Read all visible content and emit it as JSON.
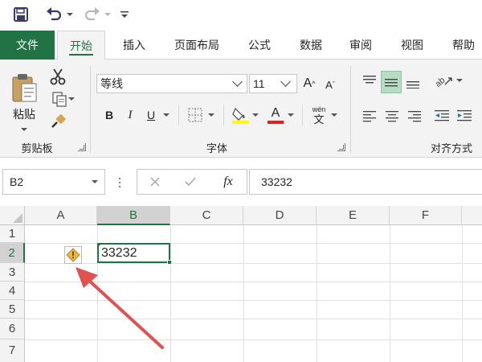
{
  "qat": {
    "save_icon": "save-icon",
    "undo_icon": "undo-icon",
    "redo_icon": "redo-icon",
    "customize_icon": "customize-qat-icon"
  },
  "tabs": [
    {
      "label": "文件",
      "active": false
    },
    {
      "label": "开始",
      "active": true
    },
    {
      "label": "插入",
      "active": false
    },
    {
      "label": "页面布局",
      "active": false
    },
    {
      "label": "公式",
      "active": false
    },
    {
      "label": "数据",
      "active": false
    },
    {
      "label": "审阅",
      "active": false
    },
    {
      "label": "视图",
      "active": false
    },
    {
      "label": "帮助",
      "active": false
    }
  ],
  "ribbon": {
    "clipboard": {
      "paste_label": "粘贴",
      "group_label": "剪贴板"
    },
    "font": {
      "font_name": "等线",
      "font_size": "11",
      "grow_label": "A",
      "shrink_label": "A",
      "bold_label": "B",
      "italic_label": "I",
      "underline_label": "U",
      "font_color_label": "A",
      "phonetic_top": "wén",
      "phonetic_bottom": "文",
      "group_label": "字体"
    },
    "alignment": {
      "group_label": "对齐方式"
    }
  },
  "formula_bar": {
    "name_box": "B2",
    "fx_label": "fx",
    "value": "33232"
  },
  "grid": {
    "columns": [
      "A",
      "B",
      "C",
      "D",
      "E",
      "F"
    ],
    "rows": [
      "1",
      "2",
      "3",
      "4",
      "5",
      "6",
      "7"
    ],
    "selected_cell": "B2",
    "cell_b2": "33232",
    "warning_glyph": "!"
  },
  "colors": {
    "accent": "#217346",
    "ribbon_bg": "#f3f3f3",
    "arrow": "#e05252",
    "warning_fill": "#e8b74a"
  }
}
